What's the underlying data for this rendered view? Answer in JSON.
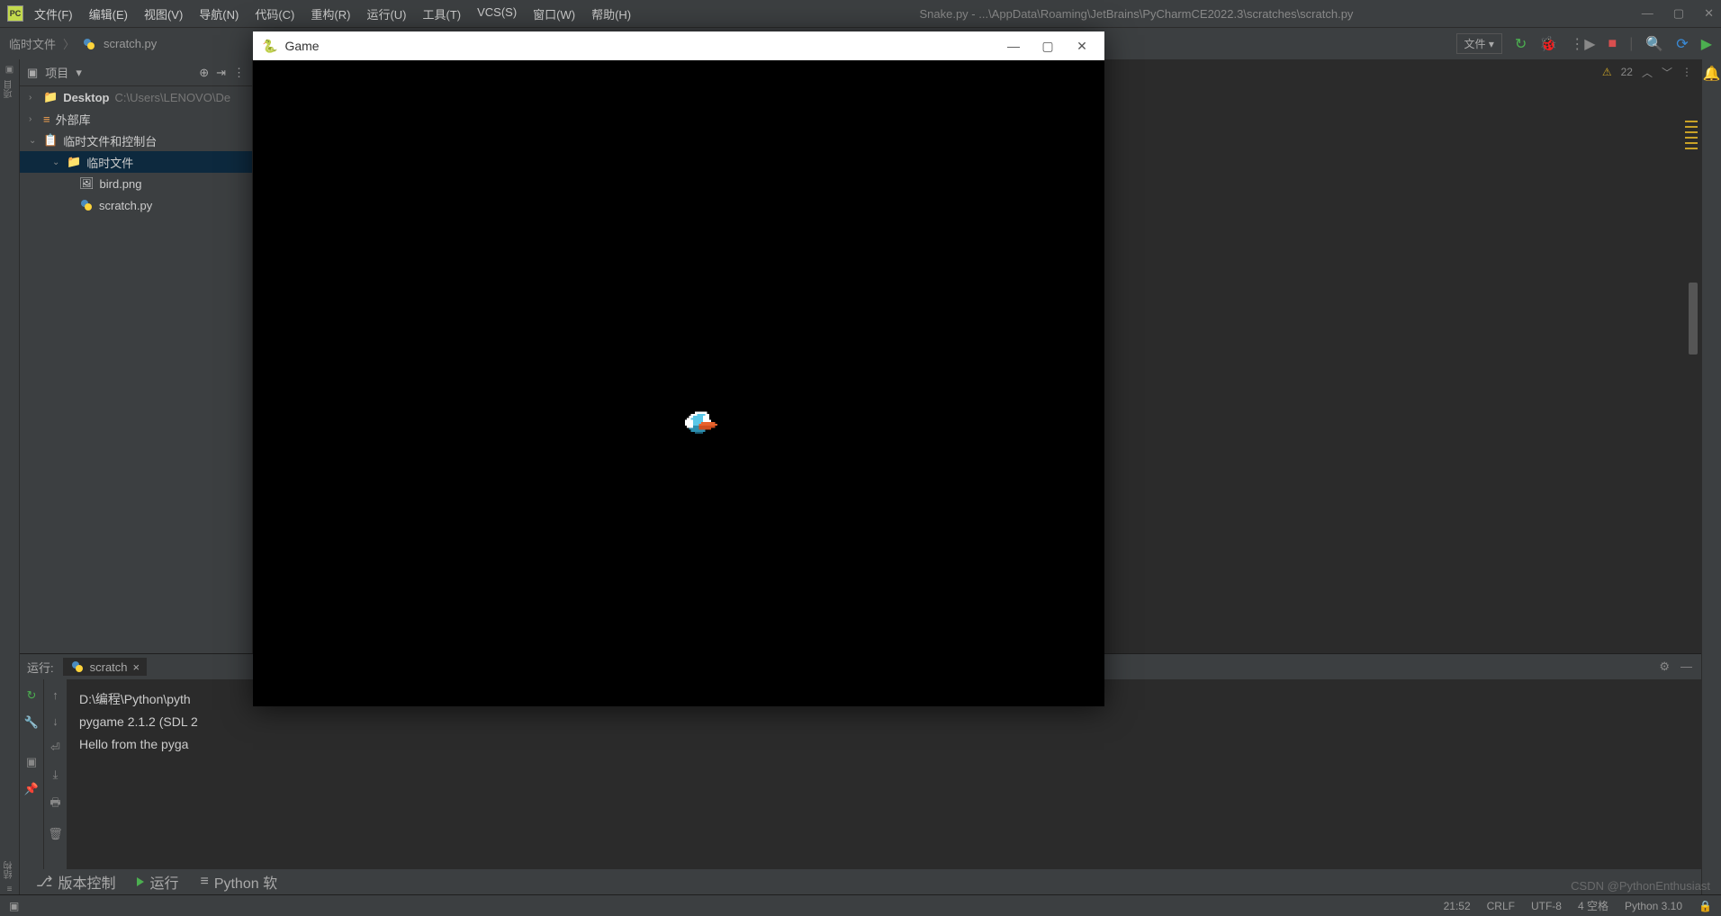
{
  "titlebar": {
    "title": "Snake.py - ...\\AppData\\Roaming\\JetBrains\\PyCharmCE2022.3\\scratches\\scratch.py",
    "menu": [
      "文件(F)",
      "编辑(E)",
      "视图(V)",
      "导航(N)",
      "代码(C)",
      "重构(R)",
      "运行(U)",
      "工具(T)",
      "VCS(S)",
      "窗口(W)",
      "帮助(H)"
    ]
  },
  "breadcrumb": {
    "a": "临时文件",
    "b": "scratch.py"
  },
  "toolbar": {
    "run_config": "文件 ▾"
  },
  "sidebar": {
    "title": "项目",
    "desktop": "Desktop",
    "desktop_path": "C:\\Users\\LENOVO\\De",
    "ext_libs": "外部库",
    "scratches": "临时文件和控制台",
    "scratch_folder": "临时文件",
    "file1": "bird.png",
    "file2": "scratch.py"
  },
  "editor": {
    "warn_count": "22"
  },
  "run": {
    "label": "运行:",
    "tab": "scratch",
    "line1": "D:\\编程\\Python\\pyth",
    "line2": "pygame 2.1.2 (SDL 2",
    "line3": "Hello from the pyga"
  },
  "bottom": {
    "vcs": "版本控制",
    "run": "运行",
    "py": "Python 软"
  },
  "status": {
    "pos": "21:52",
    "eol": "CRLF",
    "enc": "UTF-8",
    "indent": "4 空格",
    "py": "Python 3.10"
  },
  "game": {
    "title": "Game"
  },
  "watermark": "CSDN @PythonEnthusiast",
  "gutter_left": "项目",
  "gutter_left2": "结构"
}
